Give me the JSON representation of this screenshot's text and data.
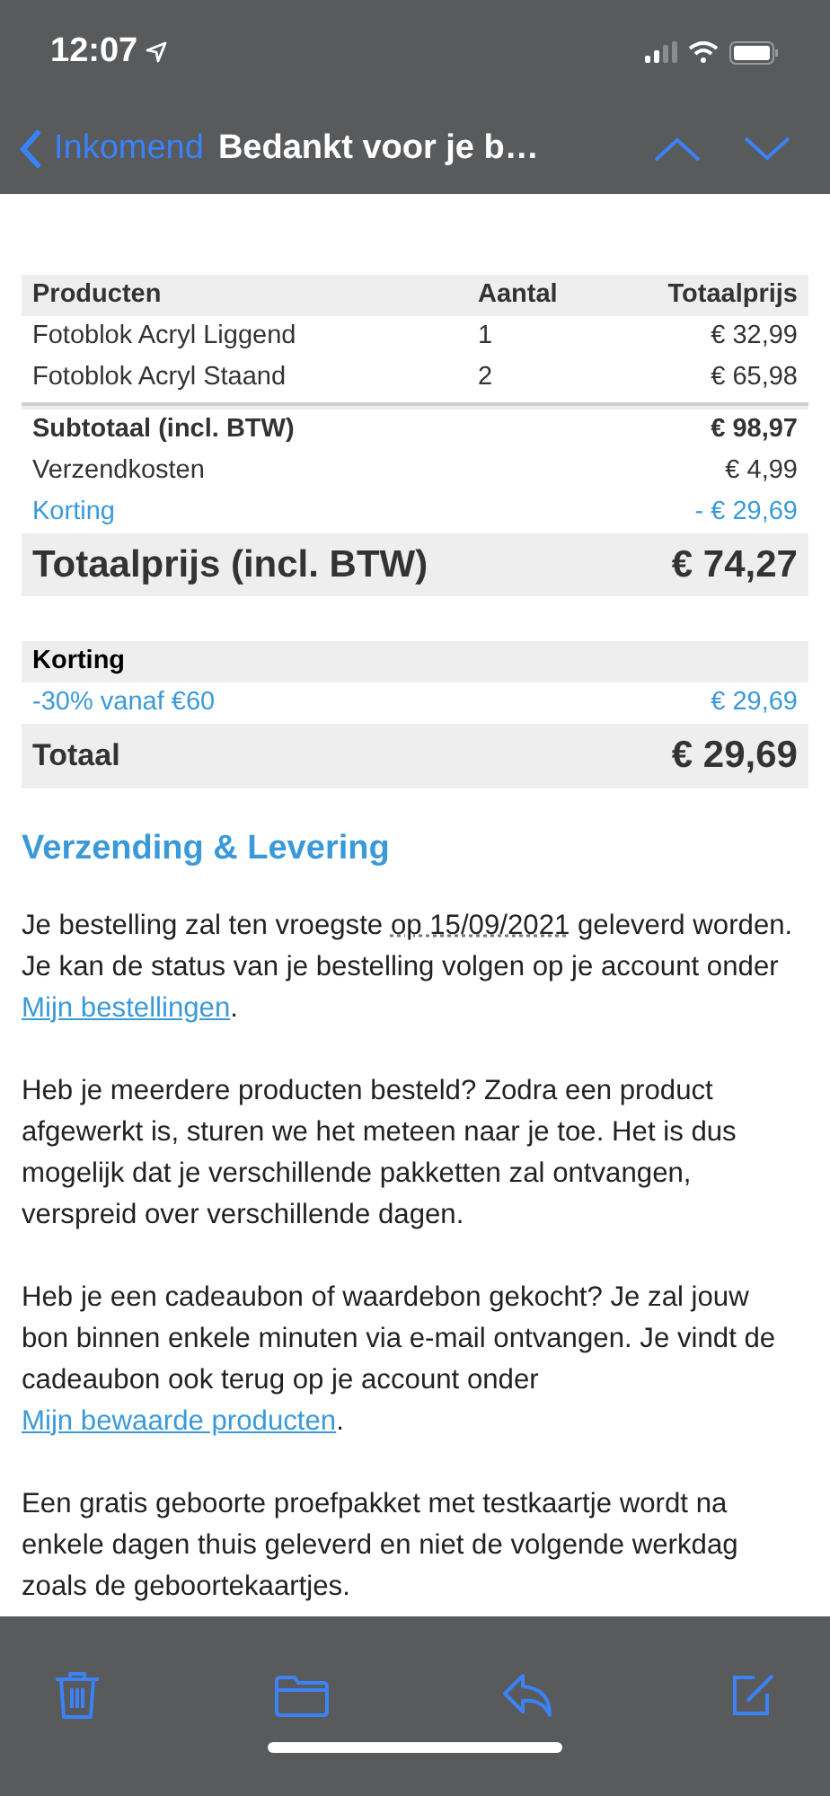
{
  "status_bar": {
    "time": "12:07"
  },
  "nav": {
    "back_label": "Inkomend",
    "title": "Bedankt voor je b…"
  },
  "order_table": {
    "columns": [
      "Producten",
      "Aantal",
      "Totaalprijs"
    ],
    "rows": [
      {
        "product": "Fotoblok Acryl Liggend",
        "quantity": "1",
        "price": "€ 32,99"
      },
      {
        "product": "Fotoblok Acryl Staand",
        "quantity": "2",
        "price": "€ 65,98"
      }
    ],
    "summary": [
      {
        "kind": "bold",
        "label": "Subtotaal (incl. BTW)",
        "value": "€ 98,97"
      },
      {
        "kind": "plain",
        "label": "Verzendkosten",
        "value": "€ 4,99"
      },
      {
        "kind": "discount",
        "label": "Korting",
        "value": "- € 29,69"
      }
    ],
    "total": {
      "label": "Totaalprijs (incl. BTW)",
      "value": "€ 74,27"
    }
  },
  "discount_table": {
    "header": "Korting",
    "rows": [
      {
        "label": "-30% vanaf €60",
        "value": "€ 29,69"
      }
    ],
    "total": {
      "label": "Totaal",
      "value": "€ 29,69"
    }
  },
  "section_heading": "Verzending & Levering",
  "paragraphs": [
    [
      {
        "kind": "text",
        "text": "Je bestelling zal ten vroegste "
      },
      {
        "kind": "date",
        "text": "op 15/09/2021"
      },
      {
        "kind": "text",
        "text": " geleverd worden. Je kan de status van je bestelling volgen op je account onder "
      },
      {
        "kind": "link",
        "text": "Mijn bestellingen"
      },
      {
        "kind": "text",
        "text": "."
      }
    ],
    [
      {
        "kind": "text",
        "text": "Heb je meerdere producten besteld? Zodra een product afgewerkt is, sturen we het meteen naar je toe. Het is dus mogelijk dat je verschillende pakketten zal ontvangen, verspreid over verschillende dagen."
      }
    ],
    [
      {
        "kind": "text",
        "text": "Heb je een cadeaubon of waardebon gekocht? Je zal jouw bon binnen enkele minuten via e-mail ontvangen. Je vindt de cadeaubon ook terug op je account onder "
      },
      {
        "kind": "link",
        "text": "Mijn bewaarde producten"
      },
      {
        "kind": "text",
        "text": "."
      }
    ],
    [
      {
        "kind": "text",
        "text": "Een gratis geboorte proefpakket met testkaartje wordt na enkele dagen thuis geleverd en niet de volgende werkdag zoals de geboortekaartjes."
      }
    ]
  ]
}
